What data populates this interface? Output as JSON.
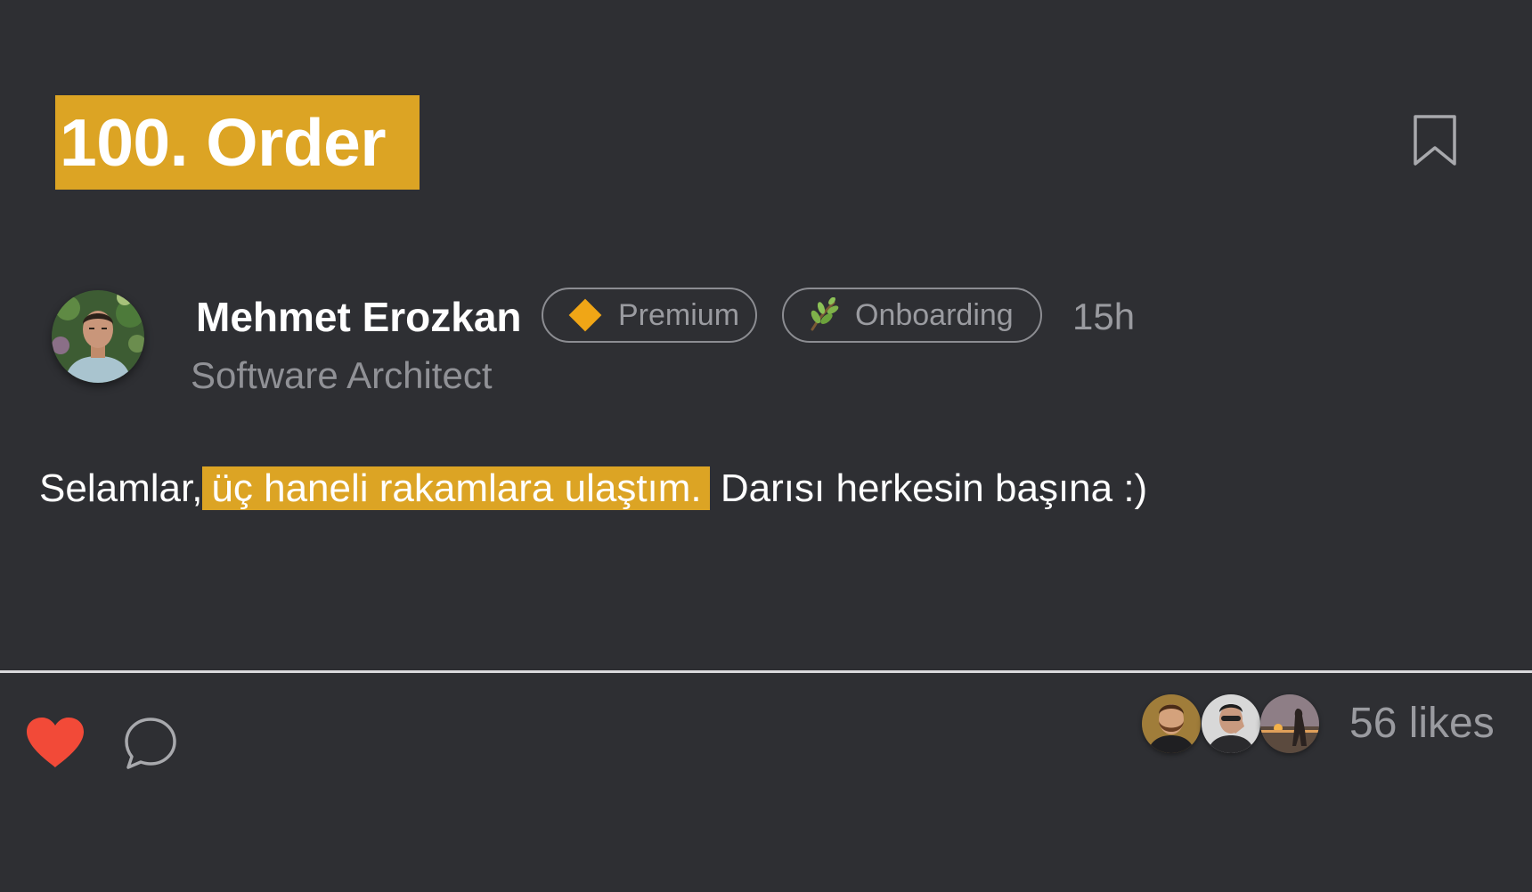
{
  "post": {
    "title": "100. Order",
    "author": {
      "name": "Mehmet Erozkan",
      "role": "Software Architect"
    },
    "badges": {
      "premium": {
        "label": "Premium",
        "icon": "diamond-icon",
        "color": "#f0a616"
      },
      "onboarding": {
        "label": "Onboarding",
        "icon": "sprout-icon"
      }
    },
    "time_ago": "15h",
    "body": {
      "before": "Selamlar,",
      "highlight": "üç haneli rakamlara ulaştım.",
      "after": " Darısı herkesin başına :)"
    }
  },
  "footer": {
    "liked": true,
    "likes_label": "56 likes"
  },
  "colors": {
    "background": "#2e2f33",
    "accent": "#dca424",
    "heart": "#f24a38",
    "muted_text": "#9a9ba0"
  }
}
